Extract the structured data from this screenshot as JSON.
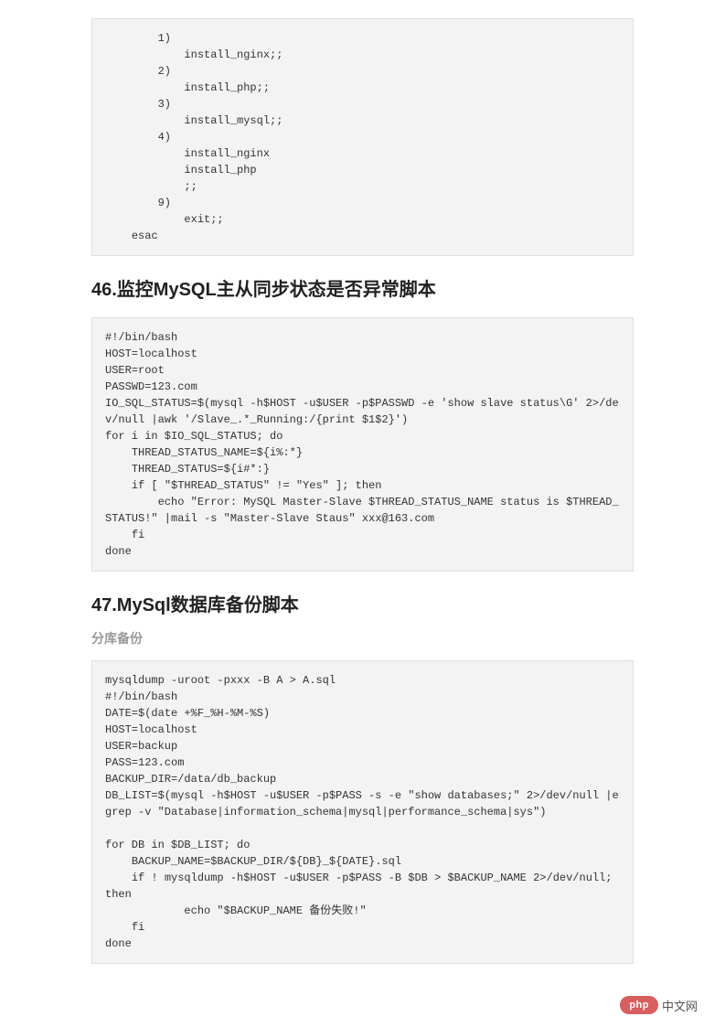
{
  "code_block_1": "        1)\n            install_nginx;;\n        2)\n            install_php;;\n        3)\n            install_mysql;;\n        4)\n            install_nginx\n            install_php\n            ;;\n        9)\n            exit;;\n    esac",
  "heading_46": "46.监控MySQL主从同步状态是否异常脚本",
  "code_block_2": "#!/bin/bash  \nHOST=localhost\nUSER=root\nPASSWD=123.com\nIO_SQL_STATUS=$(mysql -h$HOST -u$USER -p$PASSWD -e 'show slave status\\G' 2>/dev/null |awk '/Slave_.*_Running:/{print $1$2}') \nfor i in $IO_SQL_STATUS; do\n    THREAD_STATUS_NAME=${i%:*}\n    THREAD_STATUS=${i#*:}\n    if [ \"$THREAD_STATUS\" != \"Yes\" ]; then\n        echo \"Error: MySQL Master-Slave $THREAD_STATUS_NAME status is $THREAD_STATUS!\" |mail -s \"Master-Slave Staus\" xxx@163.com\n    fi\ndone",
  "heading_47": "47.MySql数据库备份脚本",
  "sub_heading_47": "分库备份",
  "code_block_3": "mysqldump -uroot -pxxx -B A > A.sql\n#!/bin/bash\nDATE=$(date +%F_%H-%M-%S)\nHOST=localhost\nUSER=backup\nPASS=123.com\nBACKUP_DIR=/data/db_backup\nDB_LIST=$(mysql -h$HOST -u$USER -p$PASS -s -e \"show databases;\" 2>/dev/null |egrep -v \"Database|information_schema|mysql|performance_schema|sys\")\n\nfor DB in $DB_LIST; do\n    BACKUP_NAME=$BACKUP_DIR/${DB}_${DATE}.sql\n    if ! mysqldump -h$HOST -u$USER -p$PASS -B $DB > $BACKUP_NAME 2>/dev/null; then\n            echo \"$BACKUP_NAME 备份失败!\"\n    fi\ndone",
  "footer": {
    "badge": "php",
    "text": "中文网"
  }
}
